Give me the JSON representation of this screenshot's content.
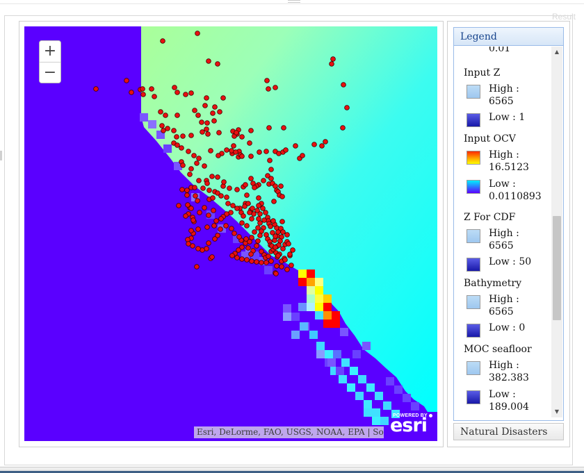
{
  "window": {
    "result_label": "Result"
  },
  "map": {
    "zoom_in_label": "+",
    "zoom_out_label": "−",
    "attribution": "Esri, DeLorme, FAO, USGS, NOAA, EPA | Sour…",
    "logo": {
      "powered_by": "POWERED BY",
      "brand": "esri"
    },
    "colors": {
      "land": "#5a00ff",
      "ocean_shallow": "#aaff99",
      "ocean_deep": "#00ffff",
      "points": "#e81010",
      "hotspot_high": "#ff0000",
      "hotspot_low": "#ffff00"
    }
  },
  "legend": {
    "title": "Legend",
    "top_partial_value": "0.01",
    "layers": [
      {
        "title": "Input Z",
        "high_label": "High :",
        "high_value": "6565",
        "low_label": "Low : 1",
        "low_value": ""
      },
      {
        "title": "Input OCV",
        "high_label": "High :",
        "high_value": "16.5123",
        "low_label": "Low :",
        "low_value": "0.0110893"
      },
      {
        "title": "Z For CDF",
        "high_label": "High :",
        "high_value": "6565",
        "low_label": "Low : 50",
        "low_value": ""
      },
      {
        "title": "Bathymetry",
        "high_label": "High :",
        "high_value": "6565",
        "low_label": "Low : 0",
        "low_value": ""
      },
      {
        "title": "MOC seafloor",
        "high_label": "High :",
        "high_value": "382.383",
        "low_label": "Low :",
        "low_value": "189.004"
      }
    ]
  },
  "tabs": {
    "natural_disasters": "Natural Disasters"
  }
}
